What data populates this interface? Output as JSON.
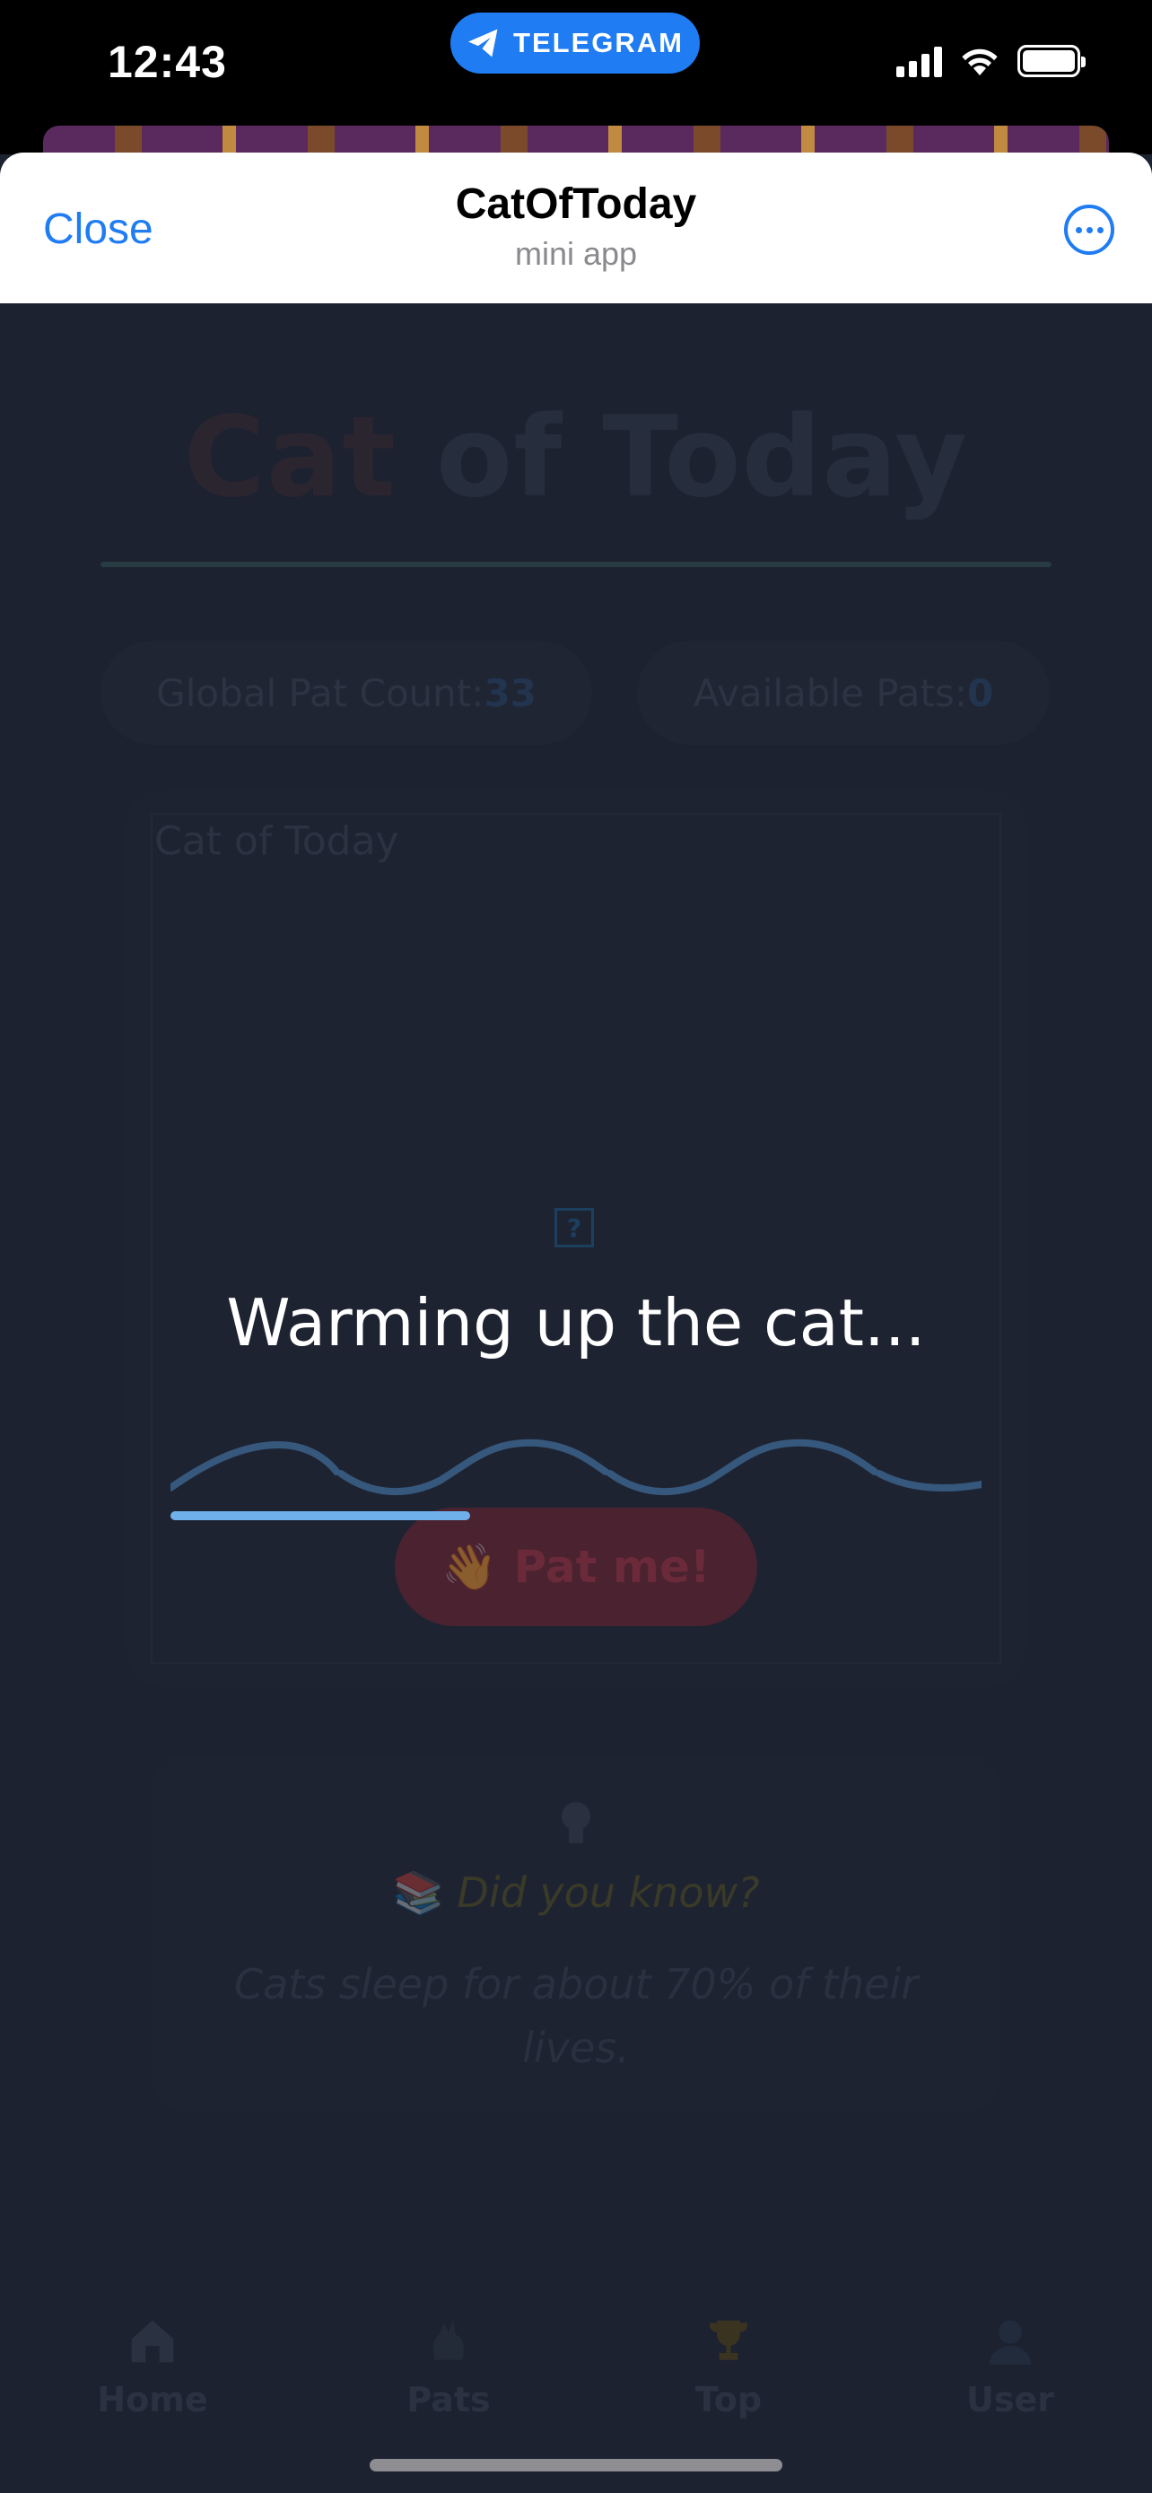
{
  "status_bar": {
    "time": "12:43",
    "pill_label": "TELEGRAM",
    "icons": [
      "signal-icon",
      "wifi-icon",
      "battery-icon"
    ]
  },
  "header": {
    "close_label": "Close",
    "title": "CatOfToday",
    "subtitle": "mini app",
    "menu_icon": "more-icon",
    "accent_color": "#1f7cf2"
  },
  "app": {
    "title_part1": "Cat",
    "title_part2": " of Today",
    "global_pat_label": "Global Pat Count:",
    "global_pat_value": "33",
    "available_pats_label": "Available Pats:",
    "available_pats_value": "0",
    "card_heading": "Cat of Today",
    "pat_button_label": "Pat me!",
    "pat_button_emoji": "👋",
    "fact_title": "Did you know?",
    "fact_title_emoji": "📚",
    "fact_text": "Cats sleep for about 70% of their lives."
  },
  "tabs": [
    {
      "label": "Home",
      "icon": "home-icon"
    },
    {
      "label": "Pats",
      "icon": "pats-icon"
    },
    {
      "label": "Top",
      "icon": "trophy-icon"
    },
    {
      "label": "User",
      "icon": "user-icon"
    }
  ],
  "loading": {
    "text": "Warming up the cat...",
    "progress_fraction": 0.37,
    "progress_color": "#6fb0ea"
  }
}
